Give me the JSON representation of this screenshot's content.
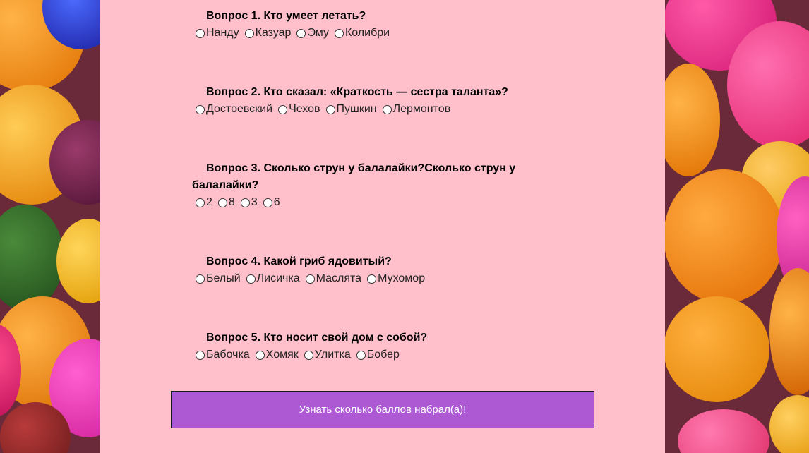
{
  "colors": {
    "panel": "#ffc0cb",
    "button": "#ac59d3"
  },
  "questions": [
    {
      "title": "Вопрос 1. Кто умеет летать?",
      "options": [
        "Нанду",
        "Казуар",
        "Эму",
        "Колибри"
      ]
    },
    {
      "title": "Вопрос 2. Кто сказал: «Краткость — сестра таланта»?",
      "options": [
        "Достоевский",
        "Чехов",
        "Пушкин",
        "Лермонтов"
      ]
    },
    {
      "title": "Вопрос 3. Сколько струн у балалайки?Сколько струн у балалайки?",
      "options": [
        "2",
        "8",
        "3",
        "6"
      ]
    },
    {
      "title": "Вопрос 4. Какой гриб ядовитый?",
      "options": [
        "Белый",
        "Лисичка",
        "Маслята",
        "Мухомор"
      ]
    },
    {
      "title": "Вопрос 5. Кто носит свой дом с собой?",
      "options": [
        "Бабочка",
        "Хомяк",
        "Улитка",
        "Бобер"
      ]
    }
  ],
  "submit_label": "Узнать сколько баллов набрал(а)!"
}
